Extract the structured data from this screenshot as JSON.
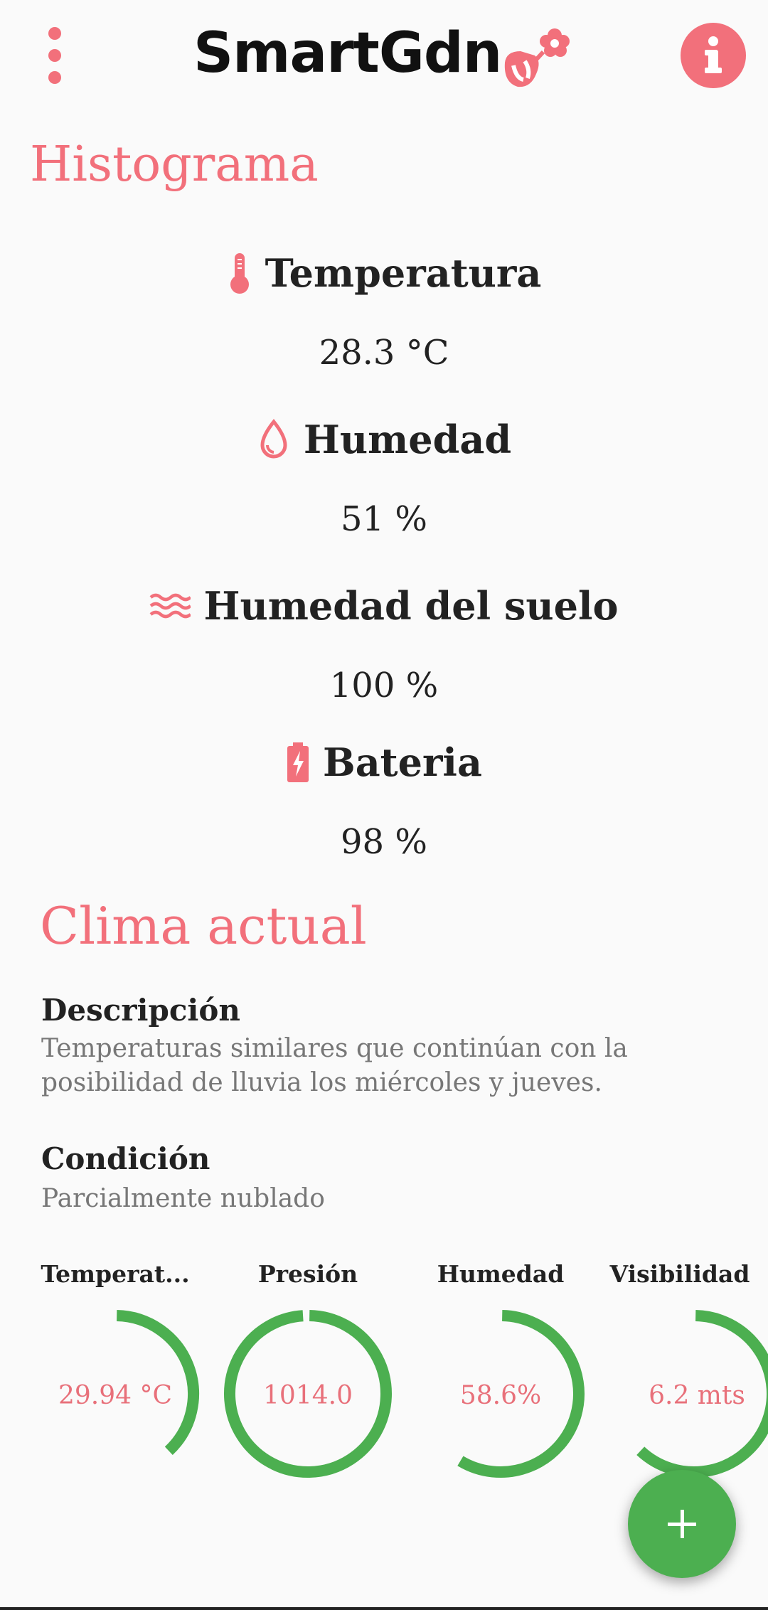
{
  "app": {
    "title": "SmartGdn",
    "menu_icon": "more-vert-icon",
    "logo_icon": "flower-pot-icon",
    "info_icon": "info-icon",
    "accent_color": "#f2707b",
    "gauge_color": "#4caf50"
  },
  "histogram": {
    "title": "Histograma",
    "metrics": [
      {
        "label": "Temperatura",
        "value": "28.3 °C",
        "icon": "thermometer-icon"
      },
      {
        "label": "Humedad",
        "value": "51 %",
        "icon": "water-drop-icon"
      },
      {
        "label": "Humedad del suelo",
        "value": "100 %",
        "icon": "waves-icon"
      },
      {
        "label": "Bateria",
        "value": "98 %",
        "icon": "battery-charging-icon"
      }
    ]
  },
  "clima": {
    "title": "Clima actual",
    "descripcion_label": "Descripción",
    "descripcion_text": "Temperaturas similares que continúan con la posibilidad de lluvia los miércoles y jueves.",
    "condicion_label": "Condición",
    "condicion_text": "Parcialmente nublado",
    "gauges": [
      {
        "label": "Temperat...",
        "value": "29.94 °C",
        "fraction": 0.38
      },
      {
        "label": "Presión",
        "value": "1014.0",
        "fraction": 0.99
      },
      {
        "label": "Humedad",
        "value": "58.6%",
        "fraction": 0.586
      },
      {
        "label": "Visibilidad",
        "value": "6.2 mts",
        "fraction": 0.62
      }
    ]
  },
  "fab": {
    "icon": "plus-icon"
  }
}
